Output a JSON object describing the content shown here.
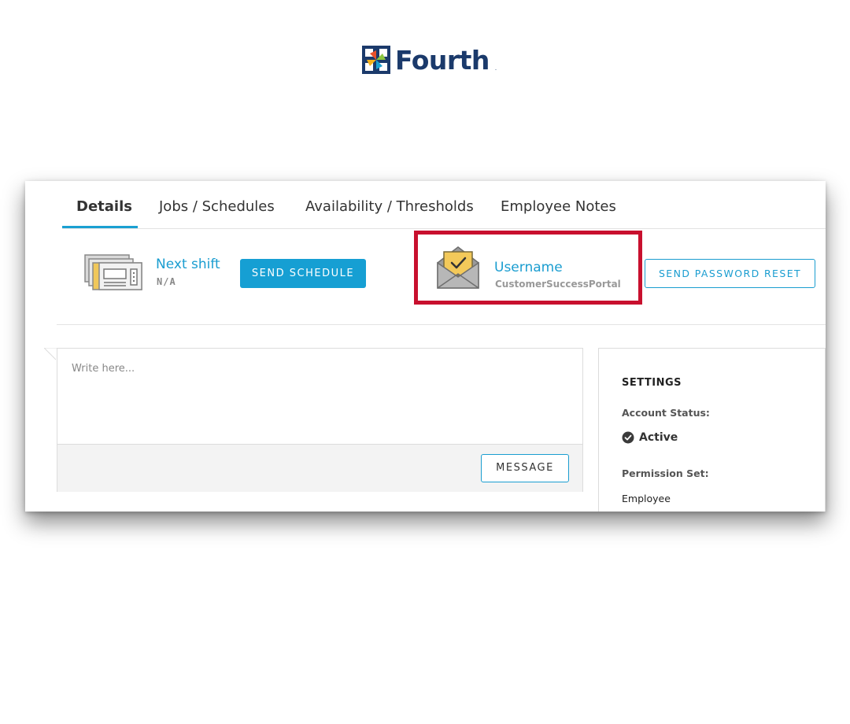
{
  "brand": {
    "name": "Fourth",
    "dot": ".",
    "colors": {
      "navy": "#1b3a6b",
      "blue": "#1a9dd0",
      "highlight": "#c8102e"
    }
  },
  "tabs": [
    {
      "label": "Details",
      "active": true
    },
    {
      "label": "Jobs / Schedules",
      "active": false
    },
    {
      "label": "Availability / Thresholds",
      "active": false
    },
    {
      "label": "Employee Notes",
      "active": false
    }
  ],
  "shift": {
    "icon": "schedule-documents-icon",
    "label": "Next shift",
    "value": "N/A",
    "button": "SEND SCHEDULE"
  },
  "account": {
    "icon": "envelope-check-icon",
    "label": "Username",
    "value": "CustomerSuccessPortal",
    "button": "SEND PASSWORD RESET"
  },
  "message": {
    "placeholder": "Write here...",
    "button": "MESSAGE"
  },
  "settings": {
    "title": "SETTINGS",
    "account_status_label": "Account Status:",
    "account_status_value": "Active",
    "status_icon": "check-circle-icon",
    "permission_label": "Permission Set:",
    "permission_value": "Employee"
  }
}
